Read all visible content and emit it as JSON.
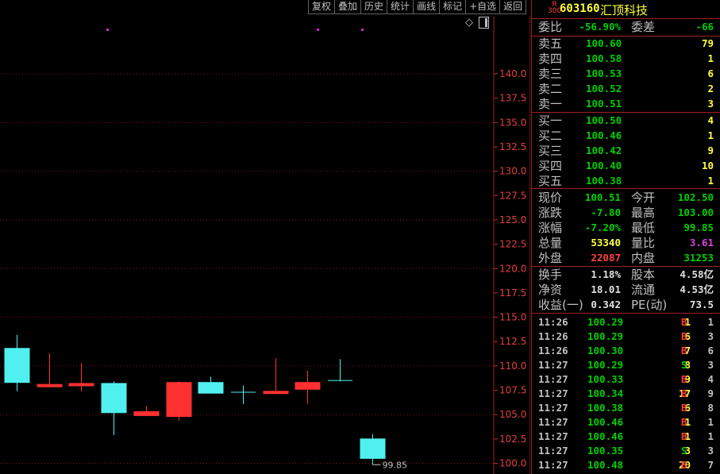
{
  "toolbar": [
    "复权",
    "叠加",
    "历史",
    "统计",
    "画线",
    "标记",
    "+自选",
    "返回"
  ],
  "header": {
    "badge_top": "R",
    "badge_bottom": "300",
    "code": "603160",
    "name": "汇顶科技"
  },
  "ratio": {
    "label1": "委比",
    "value1": "-56.90%",
    "label2": "委差",
    "value2": "-66"
  },
  "asks": [
    {
      "label": "卖五",
      "price": "100.60",
      "vol": "79"
    },
    {
      "label": "卖四",
      "price": "100.58",
      "vol": "1"
    },
    {
      "label": "卖三",
      "price": "100.53",
      "vol": "6"
    },
    {
      "label": "卖二",
      "price": "100.52",
      "vol": "2"
    },
    {
      "label": "卖一",
      "price": "100.51",
      "vol": "3"
    }
  ],
  "bids": [
    {
      "label": "买一",
      "price": "100.50",
      "vol": "4"
    },
    {
      "label": "买二",
      "price": "100.46",
      "vol": "1"
    },
    {
      "label": "买三",
      "price": "100.42",
      "vol": "9"
    },
    {
      "label": "买四",
      "price": "100.40",
      "vol": "10"
    },
    {
      "label": "买五",
      "price": "100.38",
      "vol": "1"
    }
  ],
  "quote": [
    {
      "l1": "现价",
      "v1": "100.51",
      "c1": "green",
      "l2": "今开",
      "v2": "102.50",
      "c2": "green"
    },
    {
      "l1": "涨跌",
      "v1": "-7.80",
      "c1": "green",
      "l2": "最高",
      "v2": "103.00",
      "c2": "green"
    },
    {
      "l1": "涨幅",
      "v1": "-7.20%",
      "c1": "green",
      "l2": "最低",
      "v2": "99.85",
      "c2": "green"
    },
    {
      "l1": "总量",
      "v1": "53340",
      "c1": "yellow",
      "l2": "量比",
      "v2": "3.61",
      "c2": "magenta"
    },
    {
      "l1": "外盘",
      "v1": "22087",
      "c1": "red",
      "l2": "内盘",
      "v2": "31253",
      "c2": "green"
    }
  ],
  "fundamentals": [
    {
      "l1": "换手",
      "v1": "1.18%",
      "l2": "股本",
      "v2": "4.58亿"
    },
    {
      "l1": "净资",
      "v1": "18.01",
      "l2": "流通",
      "v2": "4.53亿"
    },
    {
      "l1": "收益(一)",
      "v1": "0.342",
      "l2": "PE(动)",
      "v2": "73.5"
    }
  ],
  "ticks": [
    {
      "time": "11:26",
      "price": "100.29",
      "vol": "1",
      "bs": "B",
      "cnt": "1"
    },
    {
      "time": "11:26",
      "price": "100.29",
      "vol": "6",
      "bs": "B",
      "cnt": "3"
    },
    {
      "time": "11:26",
      "price": "100.30",
      "vol": "7",
      "bs": "B",
      "cnt": "6"
    },
    {
      "time": "11:27",
      "price": "100.29",
      "vol": "8",
      "bs": "S",
      "cnt": "3"
    },
    {
      "time": "11:27",
      "price": "100.33",
      "vol": "9",
      "bs": "B",
      "cnt": "4"
    },
    {
      "time": "11:27",
      "price": "100.34",
      "vol": "17",
      "bs": "B",
      "cnt": "9"
    },
    {
      "time": "11:27",
      "price": "100.38",
      "vol": "6",
      "bs": "B",
      "cnt": "8"
    },
    {
      "time": "11:27",
      "price": "100.46",
      "vol": "1",
      "bs": "B",
      "cnt": "1"
    },
    {
      "time": "11:27",
      "price": "100.46",
      "vol": "1",
      "bs": "B",
      "cnt": "1"
    },
    {
      "time": "11:27",
      "price": "100.35",
      "vol": "3",
      "bs": "S",
      "cnt": "3"
    },
    {
      "time": "11:27",
      "price": "100.48",
      "vol": "20",
      "bs": "B",
      "cnt": "7"
    }
  ],
  "chart_data": {
    "type": "candlestick",
    "ylim": [
      99.0,
      142.0
    ],
    "y_ticks": [
      "140.0",
      "137.5",
      "135.0",
      "132.5",
      "130.0",
      "127.5",
      "125.0",
      "122.5",
      "120.0",
      "117.5",
      "115.0",
      "112.5",
      "110.0",
      "107.5",
      "105.0",
      "102.5",
      "100.0"
    ],
    "low_annotation": "99.85",
    "candles": [
      {
        "open": 108.3,
        "close": 111.8,
        "high": 113.2,
        "low": 107.4,
        "dir": "down"
      },
      {
        "open": 108.1,
        "close": 107.9,
        "high": 111.3,
        "low": 107.9,
        "dir": "up"
      },
      {
        "open": 108.2,
        "close": 108.0,
        "high": 110.3,
        "low": 107.4,
        "dir": "up"
      },
      {
        "open": 108.2,
        "close": 105.2,
        "high": 108.4,
        "low": 102.9,
        "dir": "down"
      },
      {
        "open": 104.9,
        "close": 105.3,
        "high": 105.9,
        "low": 104.9,
        "dir": "up"
      },
      {
        "open": 104.8,
        "close": 108.3,
        "high": 108.4,
        "low": 104.4,
        "dir": "up"
      },
      {
        "open": 108.3,
        "close": 107.2,
        "high": 108.9,
        "low": 107.2,
        "dir": "down"
      },
      {
        "open": 107.3,
        "close": 107.3,
        "high": 108.0,
        "low": 106.1,
        "dir": "flat"
      },
      {
        "open": 107.3,
        "close": 107.4,
        "high": 110.8,
        "low": 107.3,
        "dir": "up"
      },
      {
        "open": 107.6,
        "close": 108.3,
        "high": 109.5,
        "low": 106.1,
        "dir": "up"
      },
      {
        "open": 108.5,
        "close": 108.5,
        "high": 110.7,
        "low": 108.4,
        "dir": "flat"
      },
      {
        "open": 102.5,
        "close": 100.5,
        "high": 103.0,
        "low": 99.85,
        "dir": "down"
      }
    ],
    "markers": [
      {
        "candle": 2.8,
        "price": 137.3
      },
      {
        "candle": 9.3,
        "price": 137.3
      },
      {
        "candle": 10.7,
        "price": 137.3
      }
    ]
  }
}
